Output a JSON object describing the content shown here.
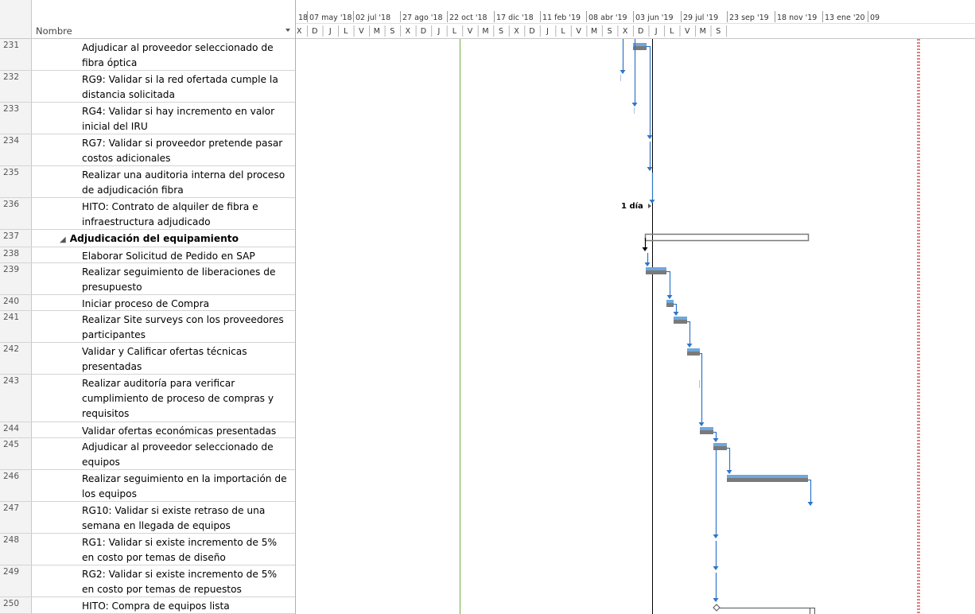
{
  "table": {
    "column_name_header": "Nombre",
    "rows": [
      {
        "id": "231",
        "name": "Adjudicar al proveedor seleccionado de fibra óptica",
        "summary": false
      },
      {
        "id": "232",
        "name": "RG9: Validar si la red ofertada cumple la distancia solicitada",
        "summary": false
      },
      {
        "id": "233",
        "name": "RG4: Validar si hay incremento en valor inicial del IRU",
        "summary": false
      },
      {
        "id": "234",
        "name": "RG7: Validar si proveedor pretende pasar costos adicionales",
        "summary": false
      },
      {
        "id": "235",
        "name": "Realizar una auditoria interna del proceso de adjudicación fibra",
        "summary": false
      },
      {
        "id": "236",
        "name": "HITO:  Contrato de alquiler de fibra e infraestructura adjudicado",
        "summary": false
      },
      {
        "id": "237",
        "name": "Adjudicación del equipamiento",
        "summary": true
      },
      {
        "id": "238",
        "name": "Elaborar Solicitud de Pedido en SAP",
        "summary": false
      },
      {
        "id": "239",
        "name": "Realizar seguimiento de liberaciones de presupuesto",
        "summary": false
      },
      {
        "id": "240",
        "name": "Iniciar proceso de Compra",
        "summary": false
      },
      {
        "id": "241",
        "name": "Realizar Site surveys con los proveedores participantes",
        "summary": false
      },
      {
        "id": "242",
        "name": "Validar y Calificar ofertas técnicas presentadas",
        "summary": false
      },
      {
        "id": "243",
        "name": "Realizar auditoría para verificar cumplimiento de proceso de compras y requisitos",
        "summary": false
      },
      {
        "id": "244",
        "name": "Validar ofertas económicas presentadas",
        "summary": false
      },
      {
        "id": "245",
        "name": "Adjudicar al proveedor seleccionado de equipos",
        "summary": false
      },
      {
        "id": "246",
        "name": "Realizar seguimiento en la importación de los equipos",
        "summary": false
      },
      {
        "id": "247",
        "name": "RG10: Validar si existe retraso de una semana en llegada de equipos",
        "summary": false
      },
      {
        "id": "248",
        "name": "RG1: Validar si existe incremento de 5% en costo por temas de diseño",
        "summary": false
      },
      {
        "id": "249",
        "name": "RG2: Validar si existe incremento de 5% en costo por temas de repuestos",
        "summary": false
      },
      {
        "id": "250",
        "name": "HITO: Compra de equipos lista",
        "summary": false
      }
    ]
  },
  "timescale": {
    "top_tier": [
      "18",
      "07 may '18",
      "02 jul '18",
      "27 ago '18",
      "22 oct '18",
      "17 dic '18",
      "11 feb '19",
      "08 abr '19",
      "03 jun '19",
      "29 jul '19",
      "23 sep '19",
      "18 nov '19",
      "13 ene '20",
      "09"
    ],
    "bottom_tier": [
      "X",
      "D",
      "J",
      "L",
      "V",
      "M",
      "S",
      "X",
      "D",
      "J",
      "L",
      "V",
      "M",
      "S",
      "X",
      "D",
      "J",
      "L",
      "V",
      "M",
      "S",
      "X",
      "D",
      "J",
      "L",
      "V",
      "M",
      "S"
    ]
  },
  "gantt": {
    "milestone_duration_label": "1 día",
    "colors": {
      "task_bar": "#7a7a7a",
      "progress_bar": "#6fa8dc",
      "link_arrow": "#2e75c8",
      "summary_outline": "#7a7a7a",
      "status_date_line": "#000000",
      "today_line": "#c00000",
      "green_line": "#70ad47"
    }
  }
}
